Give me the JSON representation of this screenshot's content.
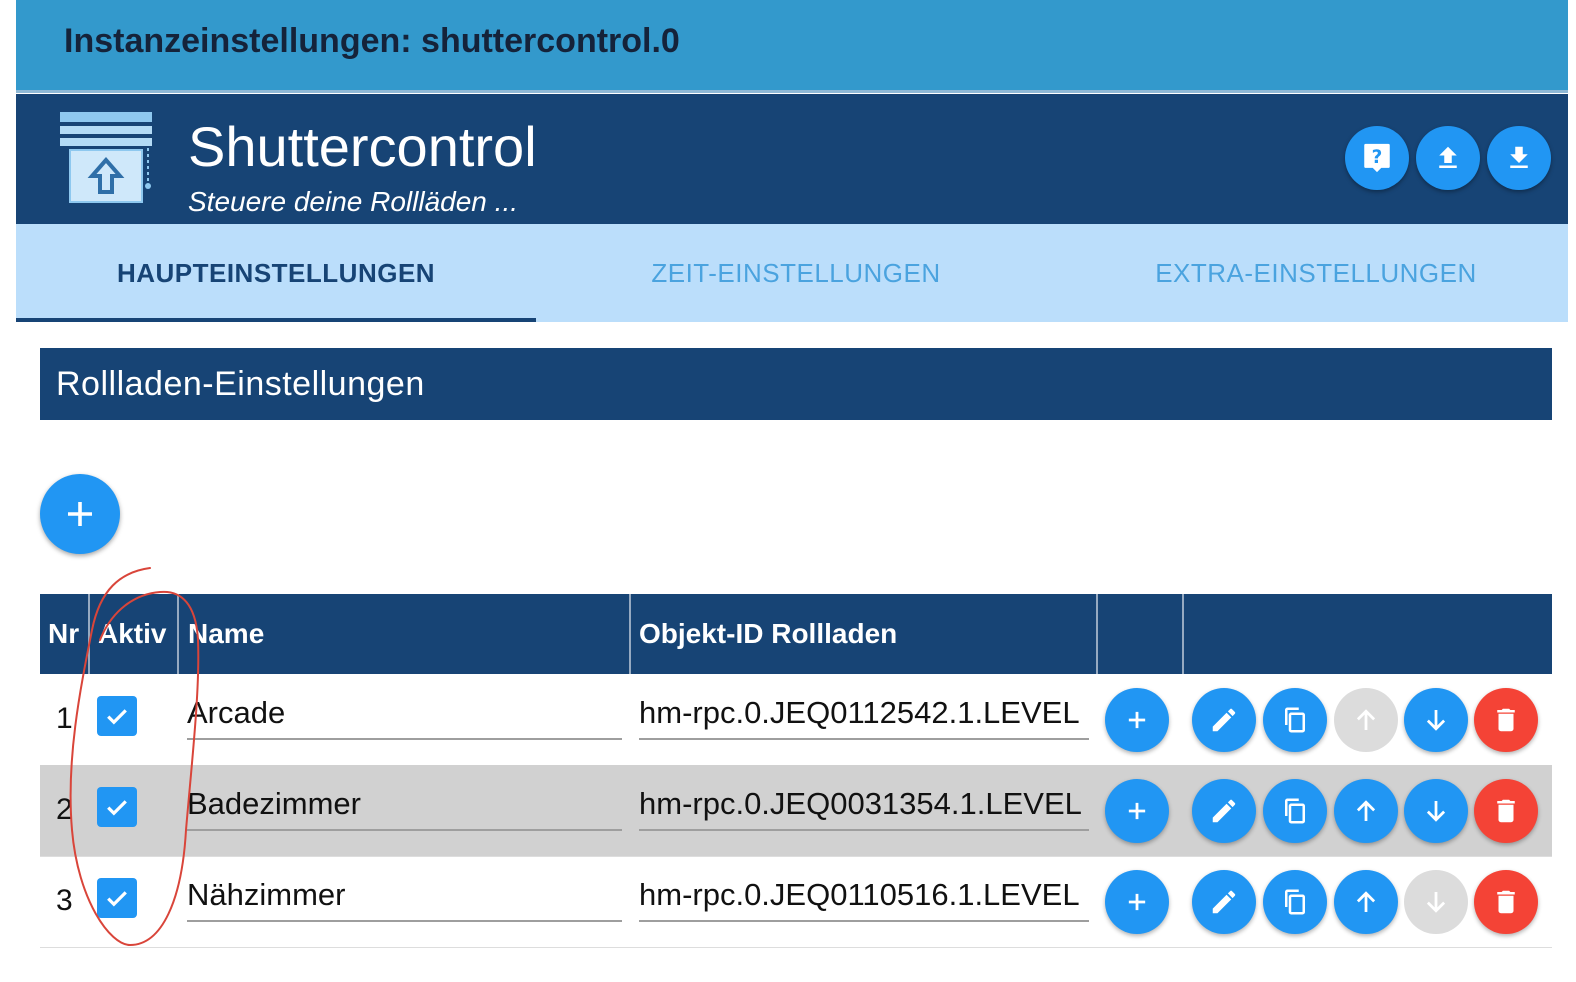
{
  "window": {
    "title": "Instanzeinstellungen: shuttercontrol.0"
  },
  "header": {
    "app_name": "Shuttercontrol",
    "subtitle": "Steuere deine Rollläden ...",
    "buttons": [
      {
        "icon": "help-icon"
      },
      {
        "icon": "upload-icon"
      },
      {
        "icon": "download-icon"
      }
    ]
  },
  "tabs": [
    {
      "label": "HAUPTEINSTELLUNGEN",
      "active": true
    },
    {
      "label": "ZEIT-EINSTELLUNGEN",
      "active": false
    },
    {
      "label": "EXTRA-EINSTELLUNGEN",
      "active": false
    }
  ],
  "section": {
    "title": "Rollladen-Einstellungen"
  },
  "table": {
    "headers": {
      "nr": "Nr",
      "aktiv": "Aktiv",
      "name": "Name",
      "objekt_id": "Objekt-ID Rollladen"
    },
    "rows": [
      {
        "nr": "1",
        "aktiv": true,
        "name": "Arcade",
        "objekt_id": "hm-rpc.0.JEQ0112542.1.LEVEL",
        "up_enabled": false,
        "down_enabled": true
      },
      {
        "nr": "2",
        "aktiv": true,
        "name": "Badezimmer",
        "objekt_id": "hm-rpc.0.JEQ0031354.1.LEVEL",
        "up_enabled": true,
        "down_enabled": true
      },
      {
        "nr": "3",
        "aktiv": true,
        "name": "Nähzimmer",
        "objekt_id": "hm-rpc.0.JEQ0110516.1.LEVEL",
        "up_enabled": true,
        "down_enabled": false
      }
    ]
  },
  "colors": {
    "titlebar": "#3399cc",
    "header": "#174475",
    "tabs_bg": "#bbdefb",
    "primary_button": "#2196f3",
    "delete_button": "#f44336",
    "disabled_button": "#dcdcdc",
    "annotation": "#d9453a"
  }
}
